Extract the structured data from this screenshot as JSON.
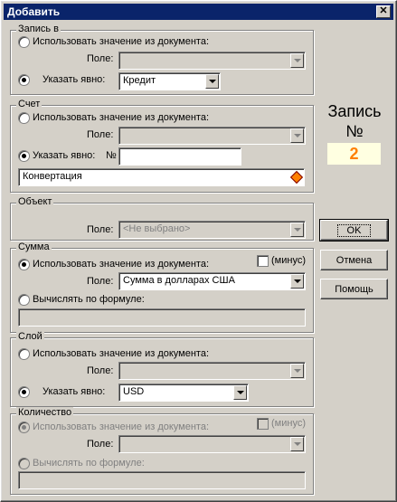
{
  "window": {
    "title": "Добавить",
    "close_icon": "close-icon"
  },
  "zapis": {
    "group_title": "Запись в",
    "use_doc_label": "Использовать значение из документа:",
    "field_label": "Поле:",
    "field_value": "",
    "explicit_label": "Указать явно:",
    "explicit_value": "Кредит"
  },
  "schet": {
    "group_title": "Счет",
    "use_doc_label": "Использовать значение из документа:",
    "field_label": "Поле:",
    "field_value": "",
    "explicit_label": "Указать явно:",
    "number_label": "№",
    "number_value": "",
    "name_value": "Конвертация"
  },
  "obekt": {
    "group_title": "Объект",
    "field_label": "Поле:",
    "field_value": "<Не выбрано>"
  },
  "summa": {
    "group_title": "Сумма",
    "use_doc_label": "Использовать значение из документа:",
    "minus_label": "(минус)",
    "field_label": "Поле:",
    "field_value": "Сумма в долларах США",
    "formula_label": "Вычислять по формуле:",
    "formula_value": ""
  },
  "sloy": {
    "group_title": "Слой",
    "use_doc_label": "Использовать значение из документа:",
    "field_label": "Поле:",
    "field_value": "",
    "explicit_label": "Указать явно:",
    "explicit_value": "USD"
  },
  "kolichestvo": {
    "group_title": "Количество",
    "use_doc_label": "Использовать значение из документа:",
    "minus_label": "(минус)",
    "field_label": "Поле:",
    "field_value": "",
    "formula_label": "Вычислять по формуле:",
    "formula_value": ""
  },
  "record": {
    "label": "Запись",
    "no_label": "№",
    "number": "2",
    "number_color": "#ff8000"
  },
  "buttons": {
    "ok": "OK",
    "cancel": "Отмена",
    "help": "Помощь"
  }
}
